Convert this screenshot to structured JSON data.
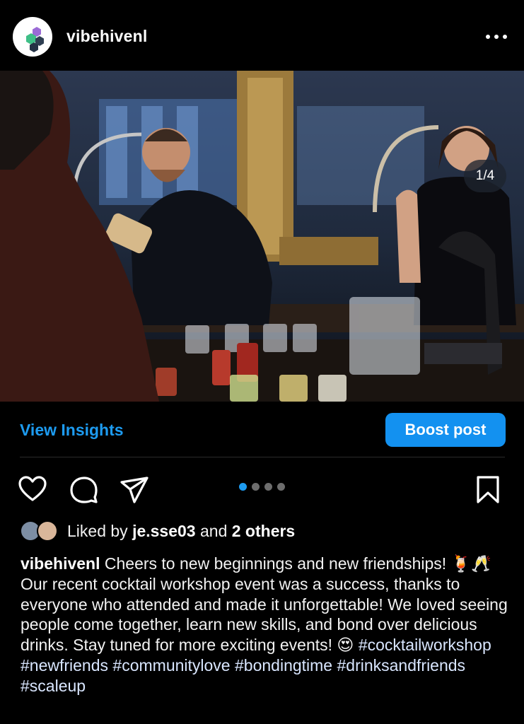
{
  "header": {
    "username": "vibehivenl",
    "avatar_icon": "hexagon-logo-icon",
    "more_icon": "more-options-icon"
  },
  "media": {
    "counter": "1/4",
    "description_icon": "photo-content"
  },
  "insights": {
    "view_label": "View Insights",
    "boost_label": "Boost post"
  },
  "actions": {
    "like_icon": "heart-icon",
    "comment_icon": "comment-icon",
    "share_icon": "send-icon",
    "save_icon": "bookmark-icon",
    "carousel_total": 4,
    "carousel_active": 1
  },
  "likes": {
    "prefix": "Liked by",
    "user": "je.sse03",
    "middle": "and",
    "others": "2 others"
  },
  "caption": {
    "username": "vibehivenl",
    "text": " Cheers to new beginnings and new friendships! 🍹🥂 Our recent cocktail workshop event was a success, thanks to everyone who attended and made it unforgettable! We loved seeing people come together, learn new skills, and bond over delicious drinks. Stay tuned for more exciting events! 😍 ",
    "hashtags": [
      "#cocktailworkshop",
      "#newfriends",
      "#communitylove",
      "#bondingtime",
      "#drinksandfriends",
      "#scaleup"
    ]
  },
  "colors": {
    "accent": "#1d9bf0",
    "boost_bg": "#1391f0",
    "background": "#000000"
  }
}
